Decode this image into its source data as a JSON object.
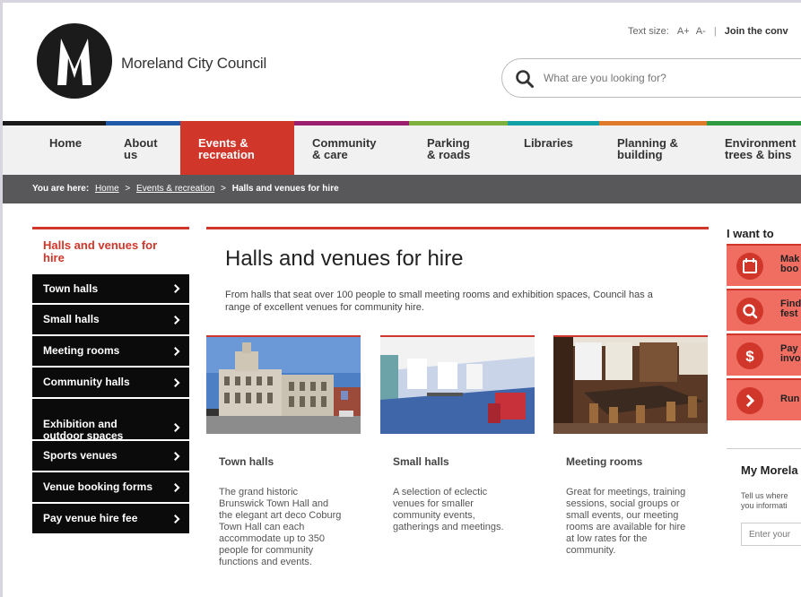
{
  "header": {
    "site_title": "Moreland City Council",
    "text_size_label": "Text size:",
    "text_size_increase": "A+",
    "text_size_decrease": "A-",
    "separator": "|",
    "join_label": "Join the conv",
    "search_placeholder": "What are you looking for?"
  },
  "nav": {
    "items": [
      {
        "label": "Home",
        "color": "#1a1a1a"
      },
      {
        "label": "About\nus",
        "color": "#1e5aa8"
      },
      {
        "label": "Events &\nrecreation",
        "color": "#d0362a",
        "active": true
      },
      {
        "label": "Community\n& care",
        "color": "#9b1f6e"
      },
      {
        "label": "Parking\n& roads",
        "color": "#7fb03e"
      },
      {
        "label": "Libraries",
        "color": "#13a1a8"
      },
      {
        "label": "Planning &\nbuilding",
        "color": "#e07a2b"
      },
      {
        "label": "Environment\ntrees & bins",
        "color": "#2f9a41"
      }
    ]
  },
  "breadcrumb": {
    "lead": "You are here:",
    "home": "Home",
    "sep1": ">",
    "section": "Events & recreation",
    "sep2": ">",
    "current": "Halls and venues for hire"
  },
  "left_nav": {
    "heading": "Halls and venues for hire",
    "items": [
      "Town halls",
      "Small halls",
      "Meeting rooms",
      "Community halls",
      "Exhibition and\noutdoor spaces",
      "Sports venues",
      "Venue booking forms",
      "Pay venue hire fee"
    ]
  },
  "main": {
    "title": "Halls and venues for hire",
    "intro": "From halls that seat over 100 people to small meeting rooms and exhibition spaces, Council has a range of excellent venues for community hire.",
    "cards": [
      {
        "title": "Town halls",
        "text": "The grand historic Brunswick Town Hall and the elegant art deco Coburg Town Hall can each accommodate up to 350 people for community functions and events."
      },
      {
        "title": "Small halls",
        "text": "A selection of eclectic venues for smaller community events, gatherings and meetings."
      },
      {
        "title": "Meeting rooms",
        "text": "Great for meetings, training sessions, social groups or small events, our meeting rooms are available for hire at low rates for the community."
      }
    ]
  },
  "right": {
    "heading": "I want to",
    "items": [
      {
        "label": "Mak\nboo",
        "icon": "calendar-icon"
      },
      {
        "label": "Find\nfest",
        "icon": "search-icon"
      },
      {
        "label": "Pay\ninvo",
        "icon": "dollar-icon"
      },
      {
        "label": "Run",
        "icon": "chevron-right-icon"
      }
    ],
    "my_title": "My Morela",
    "my_text": "Tell us where\nyou informati",
    "my_field": "Enter your"
  },
  "colors": {
    "accent": "#d0362a",
    "nav_bg": "#f1f1f1",
    "breadcrumb_bg": "#58585a",
    "left_nav_bg": "#0b0b0b",
    "iwant_bg": "#f06d62"
  }
}
